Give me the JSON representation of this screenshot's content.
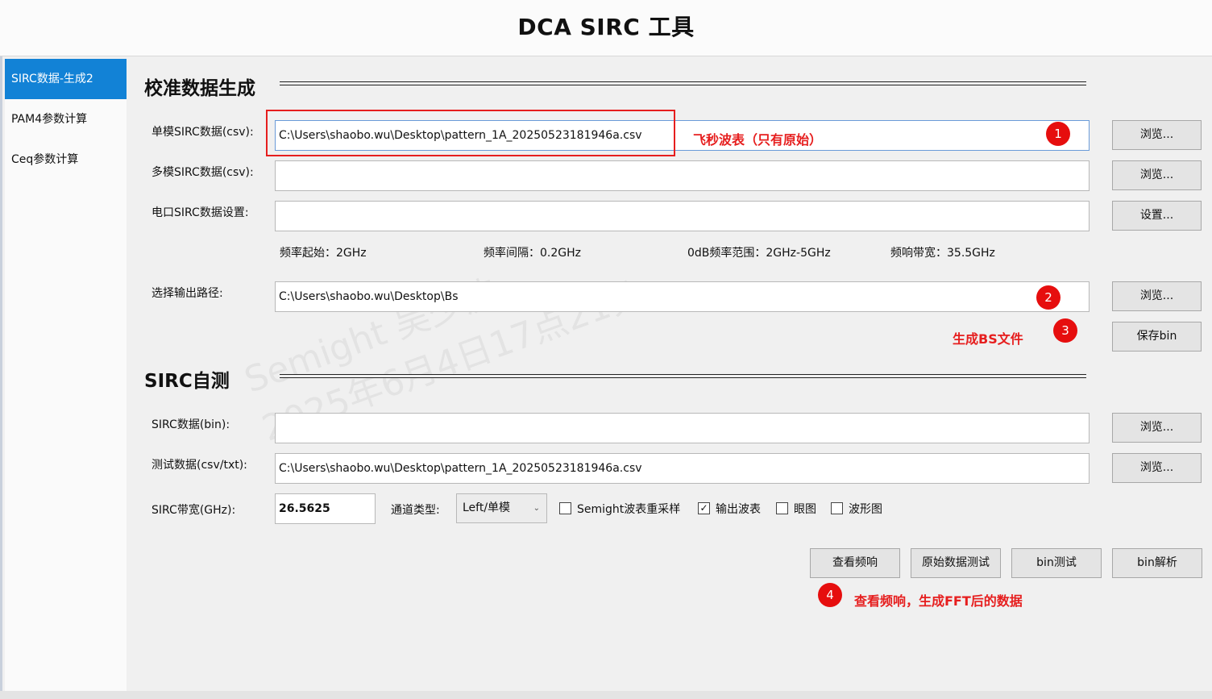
{
  "app": {
    "title": "DCA SIRC 工具"
  },
  "sidebar": {
    "items": [
      {
        "label": "SIRC数据-生成2"
      },
      {
        "label": "PAM4参数计算"
      },
      {
        "label": "Ceq参数计算"
      }
    ]
  },
  "calib": {
    "title": "校准数据生成",
    "single_label": "单模SIRC数据(csv):",
    "single_value": "C:\\Users\\shaobo.wu\\Desktop\\pattern_1A_20250523181946a.csv",
    "multi_label": "多模SIRC数据(csv):",
    "multi_value": "",
    "elec_label": "电口SIRC数据设置:",
    "elec_value": "",
    "browse": "浏览...",
    "settings": "设置...",
    "freq_start": "频率起始：2GHz",
    "freq_step": "频率间隔：0.2GHz",
    "odb_range": "0dB频率范围：2GHz-5GHz",
    "bandwidth": "频响带宽：35.5GHz",
    "output_label": "选择输出路径:",
    "output_value": "C:\\Users\\shaobo.wu\\Desktop\\Bs",
    "save_bin": "保存bin"
  },
  "selftest": {
    "title": "SIRC自测",
    "sirc_bin_label": "SIRC数据(bin):",
    "sirc_bin_value": "",
    "test_label": "测试数据(csv/txt):",
    "test_value": "C:\\Users\\shaobo.wu\\Desktop\\pattern_1A_20250523181946a.csv",
    "bw_label": "SIRC带宽(GHz):",
    "bw_value": "26.5625",
    "channel_label": "通道类型:",
    "channel_value": "Left/单模",
    "opt_resample": {
      "label": "Semight波表重采样",
      "checked": false
    },
    "opt_output": {
      "label": "输出波表",
      "checked": true
    },
    "opt_eye": {
      "label": "眼图",
      "checked": false
    },
    "opt_wave": {
      "label": "波形图",
      "checked": false
    },
    "btn_freq": "查看频响",
    "btn_raw": "原始数据测试",
    "btn_bintest": "bin测试",
    "btn_binparse": "bin解析"
  },
  "annotations": {
    "n1": "1",
    "n2": "2",
    "n3": "3",
    "n4": "4",
    "note1": "飞秒波表（只有原始）",
    "note3": "生成BS文件",
    "note4": "查看频响，生成FFT后的数据",
    "accent": "#e61e1e"
  },
  "watermark": {
    "line1": "Semight 吴少波",
    "line2": "2025年6月4日17点21分"
  },
  "colors": {
    "nav_active": "#1282d6"
  }
}
